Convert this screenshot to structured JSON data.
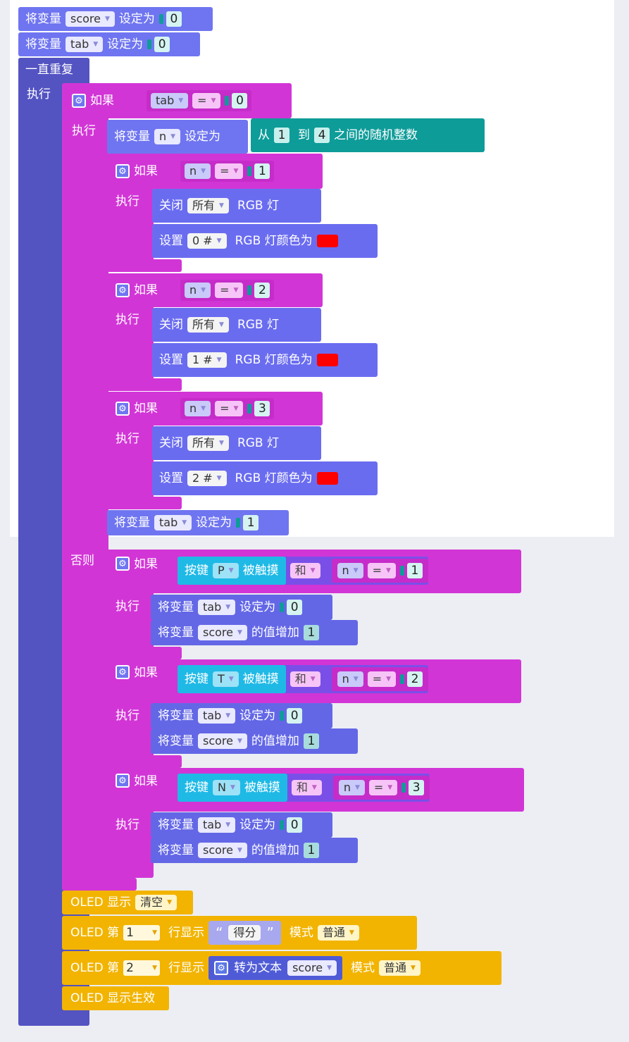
{
  "top": {
    "set_score": {
      "prefix": "将变量",
      "var": "score",
      "suffix": "设定为",
      "value": "0"
    },
    "set_tab": {
      "prefix": "将变量",
      "var": "tab",
      "suffix": "设定为",
      "value": "0"
    }
  },
  "loop": {
    "label": "一直重复",
    "do": "执行"
  },
  "if_main": {
    "if": "如果",
    "var": "tab",
    "op": "=",
    "value": "0",
    "do": "执行",
    "else": "否则"
  },
  "set_n": {
    "prefix": "将变量",
    "var": "n",
    "suffix": "设定为",
    "from": "从",
    "min": "1",
    "to": "到",
    "max": "4",
    "tail": "之间的随机整数"
  },
  "branches": [
    {
      "if": "如果",
      "var": "n",
      "op": "=",
      "value": "1",
      "do": "执行",
      "off": "关闭",
      "off_target": "所有",
      "rgb": "RGB 灯",
      "set": "设置",
      "led": "0 #",
      "color_label": "RGB 灯颜色为"
    },
    {
      "if": "如果",
      "var": "n",
      "op": "=",
      "value": "2",
      "do": "执行",
      "off": "关闭",
      "off_target": "所有",
      "rgb": "RGB 灯",
      "set": "设置",
      "led": "1 #",
      "color_label": "RGB 灯颜色为"
    },
    {
      "if": "如果",
      "var": "n",
      "op": "=",
      "value": "3",
      "do": "执行",
      "off": "关闭",
      "off_target": "所有",
      "rgb": "RGB 灯",
      "set": "设置",
      "led": "2 #",
      "color_label": "RGB 灯颜色为"
    }
  ],
  "set_tab1": {
    "prefix": "将变量",
    "var": "tab",
    "suffix": "设定为",
    "value": "1"
  },
  "else_branches": [
    {
      "if": "如果",
      "btn": "按键",
      "key": "P",
      "touched": "被触摸",
      "and": "和",
      "var": "n",
      "op": "=",
      "value": "1",
      "do": "执行",
      "set_prefix": "将变量",
      "set_var": "tab",
      "set_suffix": "设定为",
      "set_value": "0",
      "inc_prefix": "将变量",
      "inc_var": "score",
      "inc_suffix": "的值增加",
      "inc_value": "1"
    },
    {
      "if": "如果",
      "btn": "按键",
      "key": "T",
      "touched": "被触摸",
      "and": "和",
      "var": "n",
      "op": "=",
      "value": "2",
      "do": "执行",
      "set_prefix": "将变量",
      "set_var": "tab",
      "set_suffix": "设定为",
      "set_value": "0",
      "inc_prefix": "将变量",
      "inc_var": "score",
      "inc_suffix": "的值增加",
      "inc_value": "1"
    },
    {
      "if": "如果",
      "btn": "按键",
      "key": "N",
      "touched": "被触摸",
      "and": "和",
      "var": "n",
      "op": "=",
      "value": "3",
      "do": "执行",
      "set_prefix": "将变量",
      "set_var": "tab",
      "set_suffix": "设定为",
      "set_value": "0",
      "inc_prefix": "将变量",
      "inc_var": "score",
      "inc_suffix": "的值增加",
      "inc_value": "1"
    }
  ],
  "oled": {
    "clear": {
      "label": "OLED 显示",
      "mode": "清空"
    },
    "line1": {
      "label": "OLED 第",
      "line": "1",
      "show": "行显示",
      "open_q": "“",
      "text": "得分",
      "close_q": "”",
      "mode_label": "模式",
      "mode": "普通"
    },
    "line2": {
      "label": "OLED 第",
      "line": "2",
      "show": "行显示",
      "convert": "转为文本",
      "var": "score",
      "mode_label": "模式",
      "mode": "普通"
    },
    "apply": {
      "label": "OLED 显示生效"
    }
  },
  "colors": {
    "variable": "#6f75f0",
    "control": "#d235d6",
    "loop": "#5353c2",
    "math": "#0e9c99",
    "button": "#1fb9e6",
    "oled": "#f2b400",
    "led_red": "#ff0000"
  }
}
